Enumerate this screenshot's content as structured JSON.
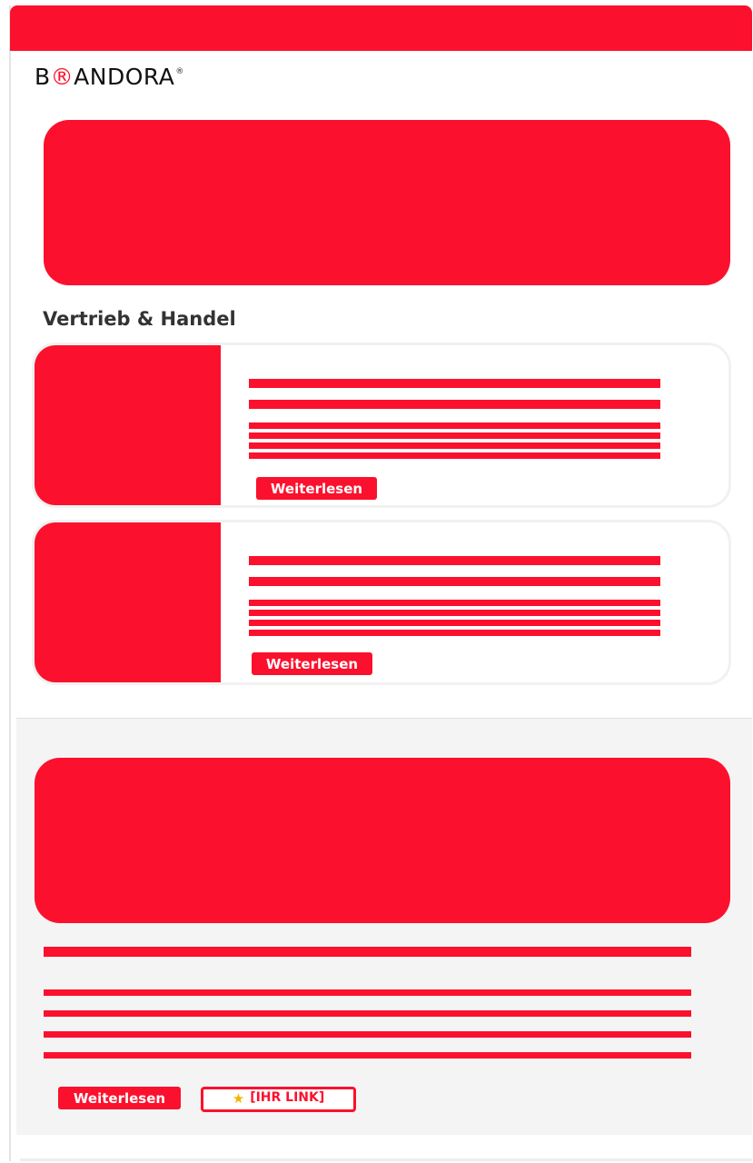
{
  "brand": {
    "logo_prefix": "B",
    "logo_mark": "®",
    "logo_suffix": "ANDORA",
    "logo_reg": "®",
    "accent_color": "#fb112d"
  },
  "section": {
    "title": "Vertrieb & Handel"
  },
  "cards": [
    {
      "button_label": "Weiterlesen"
    },
    {
      "button_label": "Weiterlesen"
    }
  ],
  "footer": {
    "button_label": "Weiterlesen",
    "link_icon": "star-icon",
    "link_label": "[IHR LINK]"
  }
}
